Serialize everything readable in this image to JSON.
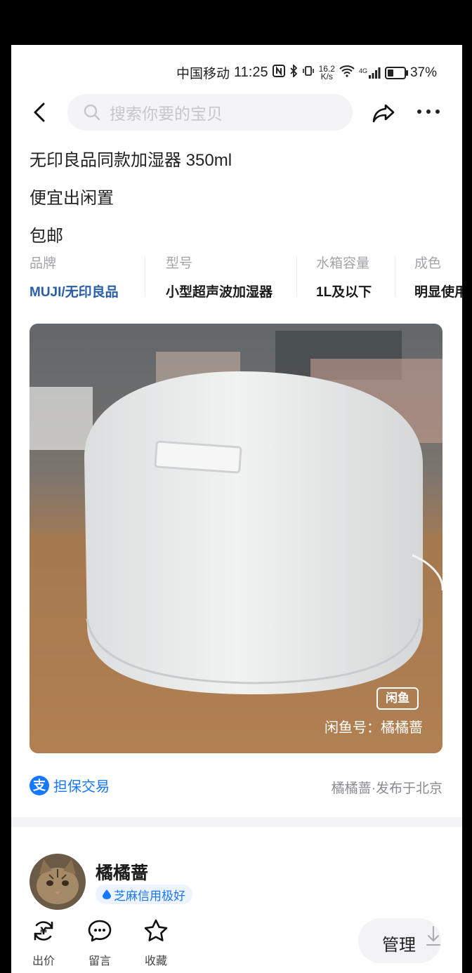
{
  "status_bar": {
    "carrier": "中国移动",
    "time": "11:25",
    "speed_value": "16.2",
    "speed_unit": "K/s",
    "network": "4G",
    "battery": "37%",
    "battery_level": 0.37
  },
  "header": {
    "search_placeholder": "搜索你要的宝贝"
  },
  "item": {
    "title_lines": [
      "无印良品同款加湿器 350ml",
      "便宜出闲置",
      "包邮"
    ],
    "attributes": [
      {
        "key": "品牌",
        "value": "MUJI/无印良品"
      },
      {
        "key": "型号",
        "value": "小型超声波加湿器"
      },
      {
        "key": "水箱容量",
        "value": "1L及以下"
      },
      {
        "key": "成色",
        "value": "明显使用"
      }
    ],
    "watermark_logo": "闲鱼",
    "watermark_text": "闲鱼号：橘橘蔷",
    "guarantee": "担保交易",
    "publish_info": "橘橘蔷·发布于北京"
  },
  "seller": {
    "name": "橘橘蔷",
    "credit": "芝麻信用极好"
  },
  "actions": {
    "offer": "出价",
    "comment": "留言",
    "favorite": "收藏",
    "manage": "管理"
  },
  "colors": {
    "accent_blue": "#1677ff",
    "brand_blue": "#2a5da8"
  }
}
